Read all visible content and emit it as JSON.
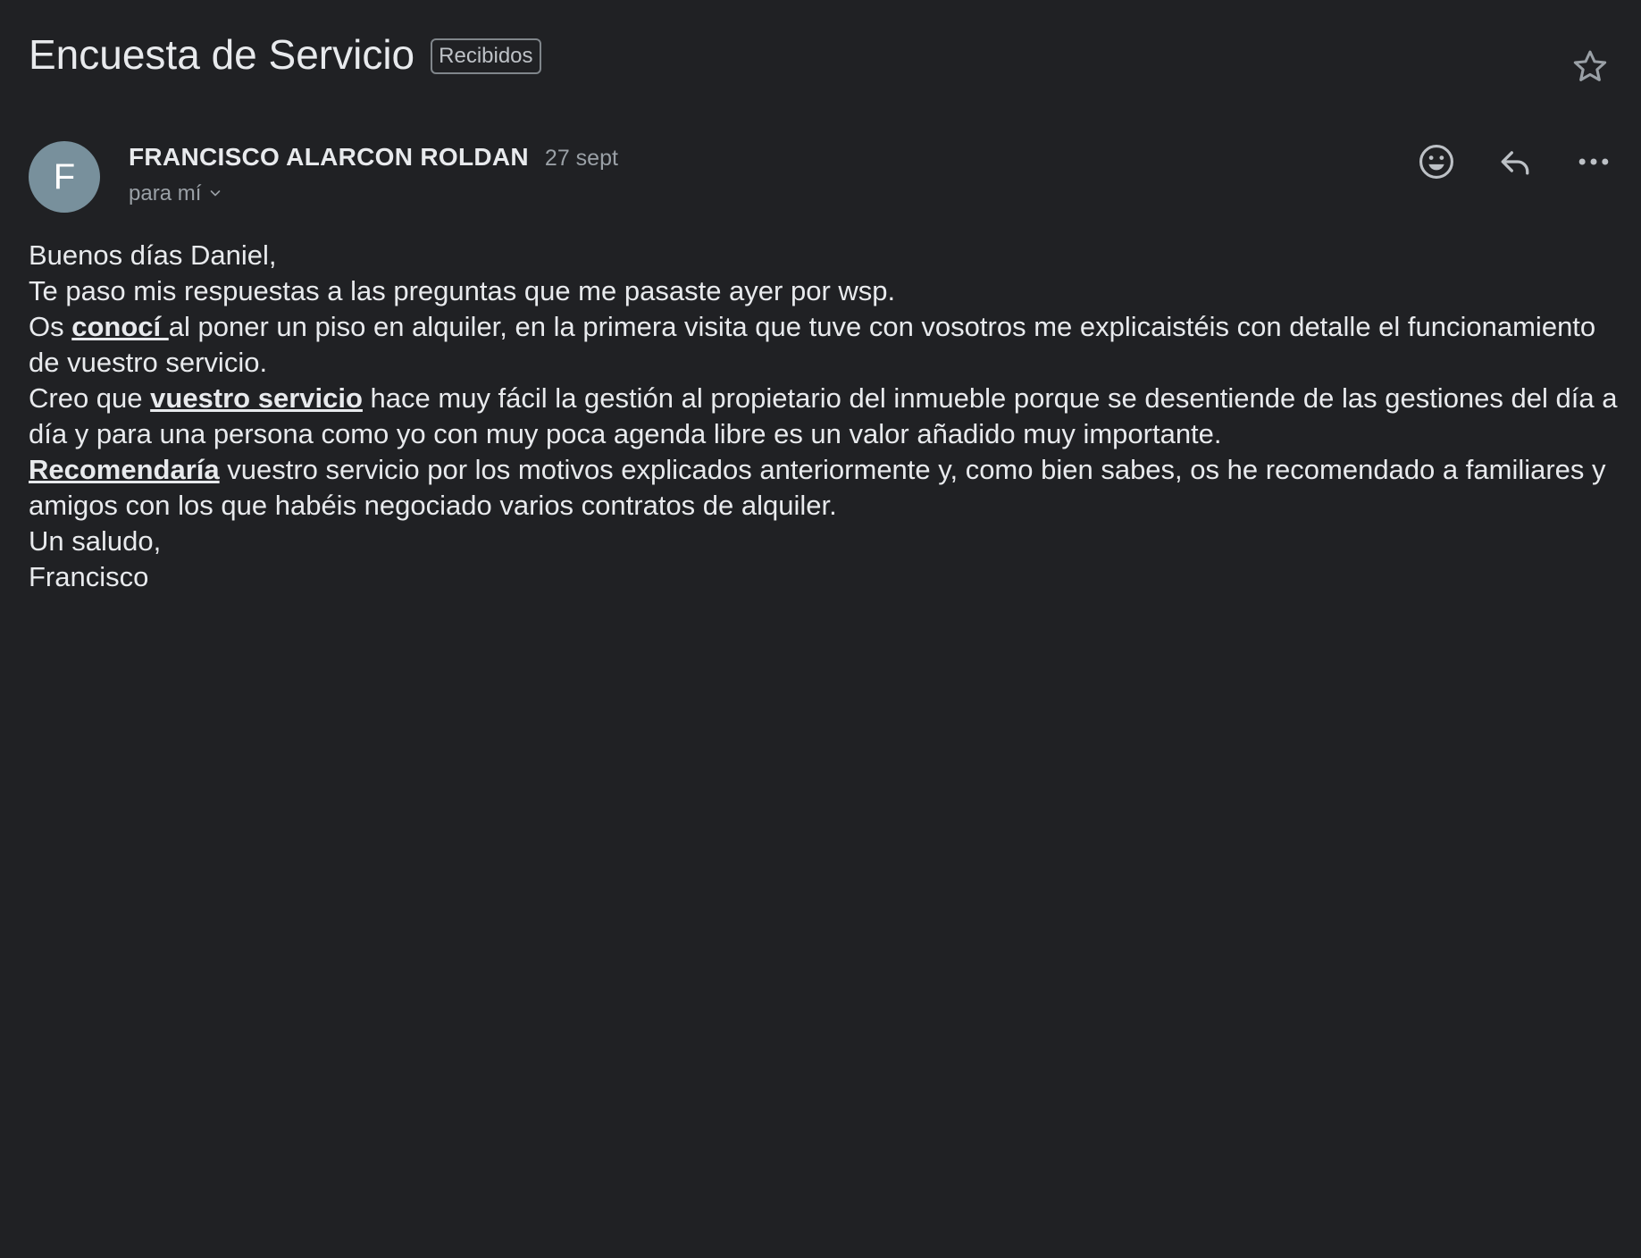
{
  "header": {
    "subject": "Encuesta de Servicio",
    "label": "Recibidos",
    "star_icon": "star-outline-icon"
  },
  "message": {
    "avatar_letter": "F",
    "avatar_color": "#78909c",
    "sender_name": "FRANCISCO ALARCON ROLDAN",
    "date": "27 sept",
    "recipient": "para mí",
    "actions": [
      "emoji-reaction-icon",
      "reply-icon",
      "more-options-icon"
    ]
  },
  "body": {
    "line1": "Buenos días Daniel,",
    "line2": "Te paso mis respuestas a las preguntas que me pasaste ayer por wsp.",
    "line3_a": "Os ",
    "line3_link": "conocí ",
    "line3_b": "al poner un piso en alquiler, en la primera visita que tuve con vosotros me explicaistéis con detalle el funcionamiento de vuestro servicio.",
    "line4_a": "Creo que ",
    "line4_link": "vuestro servicio",
    "line4_b": " hace muy fácil la gestión al propietario del inmueble porque se desentiende de las gestiones del día a día y para una persona como yo con muy poca agenda libre es un valor añadido muy importante.",
    "line5_link": "Recomendaría",
    "line5_b": " vuestro servicio por los motivos explicados anteriormente y, como bien sabes, os he recomendado a familiares y amigos con los que habéis negociado varios contratos de alquiler.",
    "line6": "Un saludo,",
    "line7": "Francisco"
  }
}
